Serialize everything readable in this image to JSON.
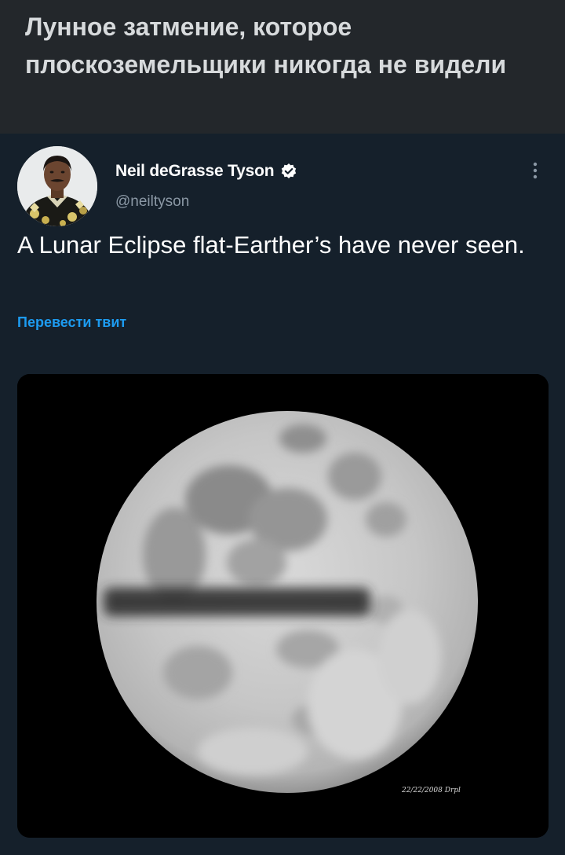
{
  "post": {
    "title": "Лунное затмение, которое плоскоземельщики никогда не видели"
  },
  "tweet": {
    "author": {
      "display_name": "Neil deGrasse Tyson",
      "handle": "@neiltyson",
      "verified": true
    },
    "text": "A Lunar Eclipse flat-Earther’s have never seen.",
    "translate_label": "Перевести твит",
    "media": {
      "watermark": "22/22/2008 Drpl"
    }
  },
  "colors": {
    "header_bg": "#23272b",
    "tweet_bg": "#15202b",
    "accent": "#1d9bf0",
    "secondary_text": "#8b98a5"
  },
  "icons": [
    "verified-badge-icon",
    "more-options-icon"
  ]
}
